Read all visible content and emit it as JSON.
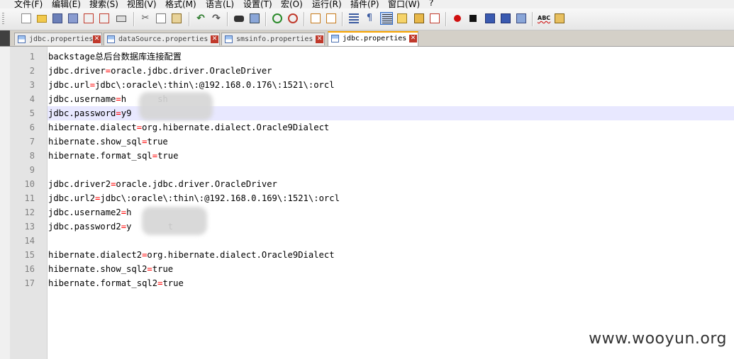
{
  "menu": [
    {
      "label": "文件(F)"
    },
    {
      "label": "编辑(E)"
    },
    {
      "label": "搜索(S)"
    },
    {
      "label": "视图(V)"
    },
    {
      "label": "格式(M)"
    },
    {
      "label": "语言(L)"
    },
    {
      "label": "设置(T)"
    },
    {
      "label": "宏(O)"
    },
    {
      "label": "运行(R)"
    },
    {
      "label": "插件(P)"
    },
    {
      "label": "窗口(W)"
    },
    {
      "label": "?"
    }
  ],
  "toolbar": {
    "spell_label": "ABC"
  },
  "tabs": [
    {
      "label": "jdbc.properties",
      "active": false
    },
    {
      "label": "dataSource.properties",
      "active": false
    },
    {
      "label": "smsinfo.properties",
      "active": false
    },
    {
      "label": "jdbc.properties",
      "active": true
    }
  ],
  "editor": {
    "current_line": 5,
    "lines": [
      {
        "num": "1",
        "key": "backstage总后台数据库连接配置",
        "eq": "",
        "val": ""
      },
      {
        "num": "2",
        "key": "jdbc.driver",
        "eq": "=",
        "val": "oracle.jdbc.driver.OracleDriver"
      },
      {
        "num": "3",
        "key": "jdbc.url",
        "eq": "=",
        "val": "jdbc\\:oracle\\:thin\\:@192.168.0.176\\:1521\\:orcl"
      },
      {
        "num": "4",
        "key": "jdbc.username",
        "eq": "=",
        "val": "h      sh"
      },
      {
        "num": "5",
        "key": "jdbc.password",
        "eq": "=",
        "val": "y9"
      },
      {
        "num": "6",
        "key": "hibernate.dialect",
        "eq": "=",
        "val": "org.hibernate.dialect.Oracle9Dialect"
      },
      {
        "num": "7",
        "key": "hibernate.show_sql",
        "eq": "=",
        "val": "true"
      },
      {
        "num": "8",
        "key": "hibernate.format_sql",
        "eq": "=",
        "val": "true"
      },
      {
        "num": "9",
        "key": "",
        "eq": "",
        "val": ""
      },
      {
        "num": "10",
        "key": "jdbc.driver2",
        "eq": "=",
        "val": "oracle.jdbc.driver.OracleDriver"
      },
      {
        "num": "11",
        "key": "jdbc.url2",
        "eq": "=",
        "val": "jdbc\\:oracle\\:thin\\:@192.168.0.169\\:1521\\:orcl"
      },
      {
        "num": "12",
        "key": "jdbc.username2",
        "eq": "=",
        "val": "h"
      },
      {
        "num": "13",
        "key": "jdbc.password2",
        "eq": "=",
        "val": "y       t"
      },
      {
        "num": "14",
        "key": "",
        "eq": "",
        "val": ""
      },
      {
        "num": "15",
        "key": "hibernate.dialect2",
        "eq": "=",
        "val": "org.hibernate.dialect.Oracle9Dialect"
      },
      {
        "num": "16",
        "key": "hibernate.show_sql2",
        "eq": "=",
        "val": "true"
      },
      {
        "num": "17",
        "key": "hibernate.format_sql2",
        "eq": "=",
        "val": "true"
      }
    ]
  },
  "watermark": "www.wooyun.org"
}
